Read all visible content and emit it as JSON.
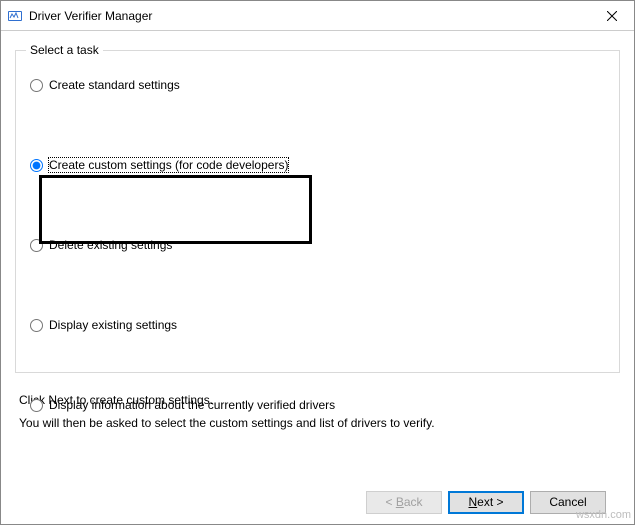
{
  "window": {
    "title": "Driver Verifier Manager"
  },
  "group": {
    "legend": "Select a task"
  },
  "options": {
    "create_standard": "Create standard settings",
    "create_custom": "Create custom settings (for code developers)",
    "delete_existing": "Delete existing settings",
    "display_existing": "Display existing settings",
    "display_info": "Display information about the currently verified drivers",
    "selected": "create_custom"
  },
  "info": {
    "line1": "Click Next to create custom settings.",
    "line2": "You will then be asked to select the custom settings and list of drivers to verify."
  },
  "buttons": {
    "back_full": "< Back",
    "next_full": "Next >",
    "cancel": "Cancel"
  },
  "watermark": "wsxdn.com"
}
